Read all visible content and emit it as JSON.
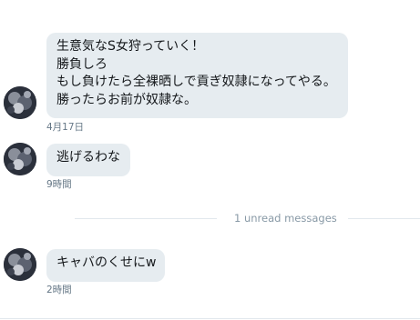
{
  "messages": [
    {
      "lines": [
        "生意気なS女狩っていく！",
        "勝負しろ",
        "もし負けたら全裸晒しで貢ぎ奴隷になってやる。",
        "勝ったらお前が奴隷な。"
      ],
      "timestamp": "4月17日"
    },
    {
      "lines": [
        "逃げるわな"
      ],
      "timestamp": "9時間"
    },
    {
      "lines": [
        "キャバのくせにw"
      ],
      "timestamp": "2時間"
    }
  ],
  "unread_divider": {
    "text": "1 unread messages"
  },
  "colors": {
    "bubble_bg": "#e6ecf0",
    "text": "#14171a",
    "timestamp": "#657786",
    "divider": "#e1e8ed",
    "divider_text": "#8899a6"
  },
  "icons": {
    "avatar": "user-avatar-image"
  }
}
